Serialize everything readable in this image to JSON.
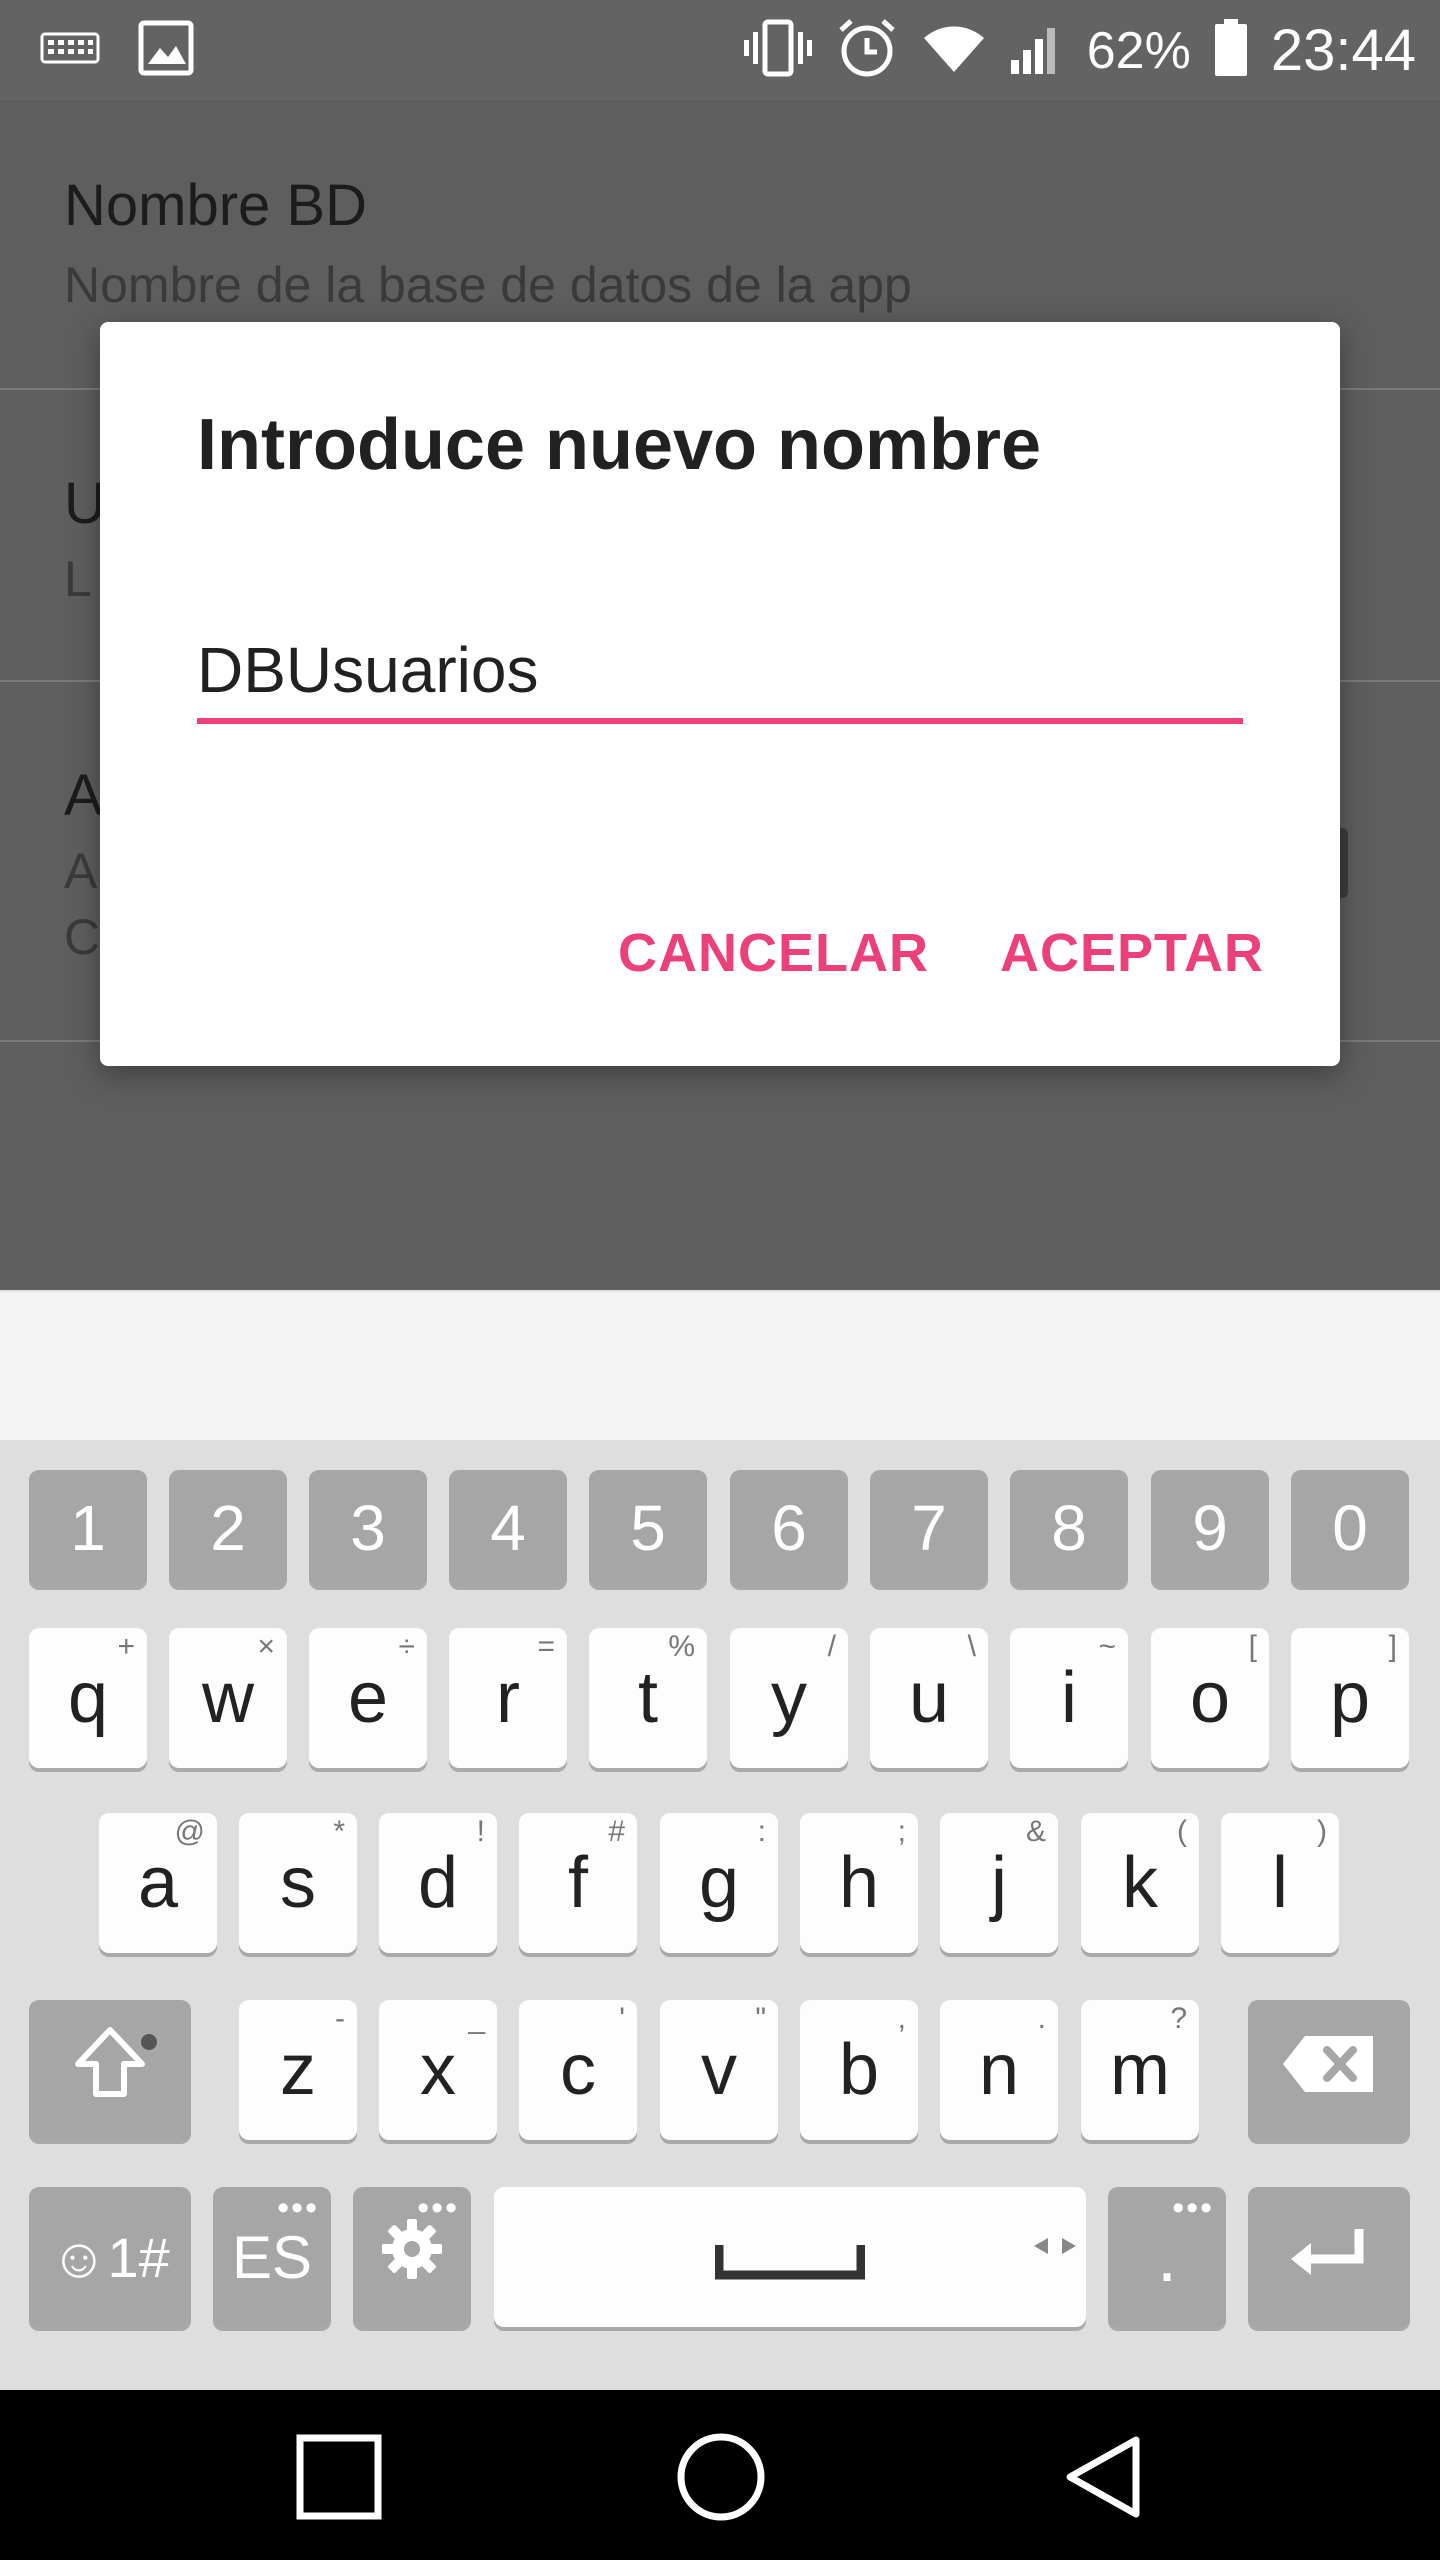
{
  "status_bar": {
    "icons_left": [
      "keyboard-icon",
      "image-icon"
    ],
    "icons_right": [
      "vibrate-icon",
      "alarm-icon",
      "wifi-icon",
      "signal-icon",
      "battery-icon"
    ],
    "battery_percent": "62%",
    "time": "23:44"
  },
  "settings": {
    "items": [
      {
        "title": "Nombre BD",
        "summary": "Nombre de la base de datos de la app"
      },
      {
        "title": "U",
        "summary": "L"
      },
      {
        "title": "A",
        "summary": "A",
        "summary2": "C"
      }
    ]
  },
  "dialog": {
    "title": "Introduce nuevo nombre",
    "input_value": "DBUsuarios",
    "cancel_label": "CANCELAR",
    "accept_label": "ACEPTAR",
    "accent_color": "#ec407a"
  },
  "keyboard": {
    "numbers": [
      "1",
      "2",
      "3",
      "4",
      "5",
      "6",
      "7",
      "8",
      "9",
      "0"
    ],
    "row1": [
      {
        "k": "q",
        "h": "+"
      },
      {
        "k": "w",
        "h": "×"
      },
      {
        "k": "e",
        "h": "÷"
      },
      {
        "k": "r",
        "h": "="
      },
      {
        "k": "t",
        "h": "%"
      },
      {
        "k": "y",
        "h": "/"
      },
      {
        "k": "u",
        "h": "\\"
      },
      {
        "k": "i",
        "h": "~"
      },
      {
        "k": "o",
        "h": "["
      },
      {
        "k": "p",
        "h": "]"
      }
    ],
    "row2": [
      {
        "k": "a",
        "h": "@"
      },
      {
        "k": "s",
        "h": "*"
      },
      {
        "k": "d",
        "h": "!"
      },
      {
        "k": "f",
        "h": "#"
      },
      {
        "k": "g",
        "h": ":"
      },
      {
        "k": "h",
        "h": ";"
      },
      {
        "k": "j",
        "h": "&"
      },
      {
        "k": "k",
        "h": "("
      },
      {
        "k": "l",
        "h": ")"
      }
    ],
    "row3": [
      {
        "k": "z",
        "h": "-"
      },
      {
        "k": "x",
        "h": "_"
      },
      {
        "k": "c",
        "h": "'"
      },
      {
        "k": "v",
        "h": "\""
      },
      {
        "k": "b",
        "h": ","
      },
      {
        "k": "n",
        "h": "."
      },
      {
        "k": "m",
        "h": "?"
      }
    ],
    "symbols_label": "☺1#",
    "language_label": "ES",
    "period_label": ".",
    "more_dots": "•••"
  },
  "nav_bar": {
    "icons": [
      "recents-icon",
      "home-icon",
      "back-icon"
    ]
  }
}
